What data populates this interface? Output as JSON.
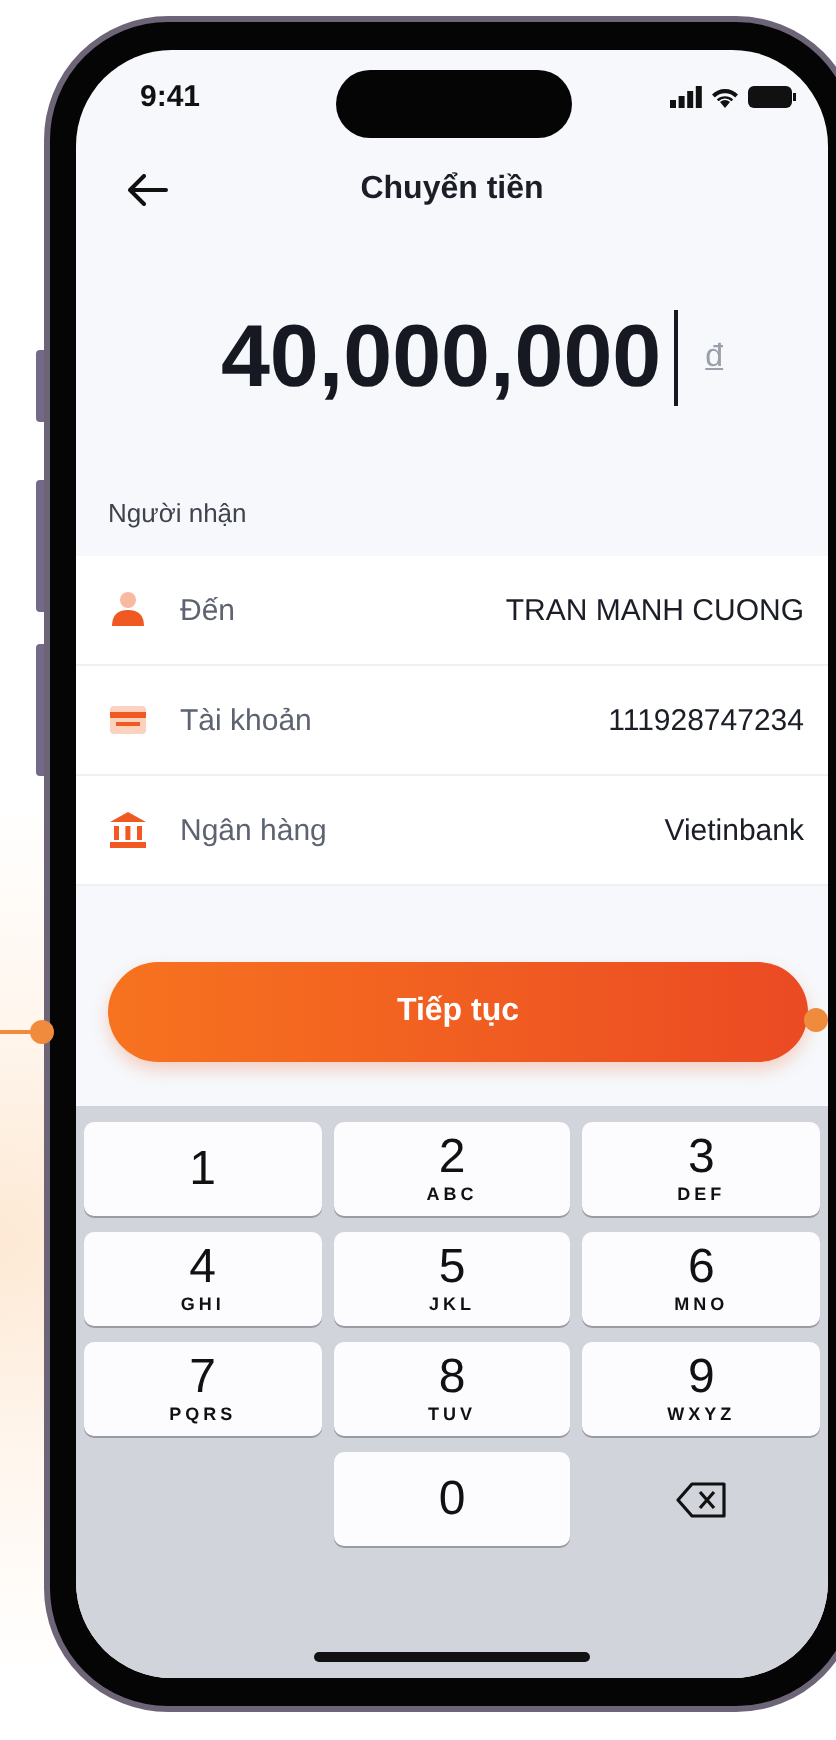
{
  "status_bar": {
    "time": "9:41"
  },
  "header": {
    "title": "Chuyển tiền"
  },
  "amount": {
    "value": "40,000,000",
    "currency": "đ"
  },
  "recipient": {
    "section_label": "Người nhận",
    "rows": [
      {
        "kind": "person",
        "label": "Đến",
        "value": "TRAN MANH CUONG"
      },
      {
        "kind": "card",
        "label": "Tài khoản",
        "value": "111928747234"
      },
      {
        "kind": "bank",
        "label": "Ngân hàng",
        "value": "Vietinbank"
      }
    ]
  },
  "continue_button": {
    "label": "Tiếp tục"
  },
  "keypad": [
    {
      "kind": "digit",
      "digit": "1"
    },
    {
      "kind": "digit",
      "digit": "2",
      "letters": "ABC"
    },
    {
      "kind": "digit",
      "digit": "3",
      "letters": "DEF"
    },
    {
      "kind": "digit",
      "digit": "4",
      "letters": "GHI"
    },
    {
      "kind": "digit",
      "digit": "5",
      "letters": "JKL"
    },
    {
      "kind": "digit",
      "digit": "6",
      "letters": "MNO"
    },
    {
      "kind": "digit",
      "digit": "7",
      "letters": "PQRS"
    },
    {
      "kind": "digit",
      "digit": "8",
      "letters": "TUV"
    },
    {
      "kind": "digit",
      "digit": "9",
      "letters": "WXYZ"
    },
    {
      "kind": "blank"
    },
    {
      "kind": "digit",
      "digit": "0"
    },
    {
      "kind": "delete"
    }
  ]
}
